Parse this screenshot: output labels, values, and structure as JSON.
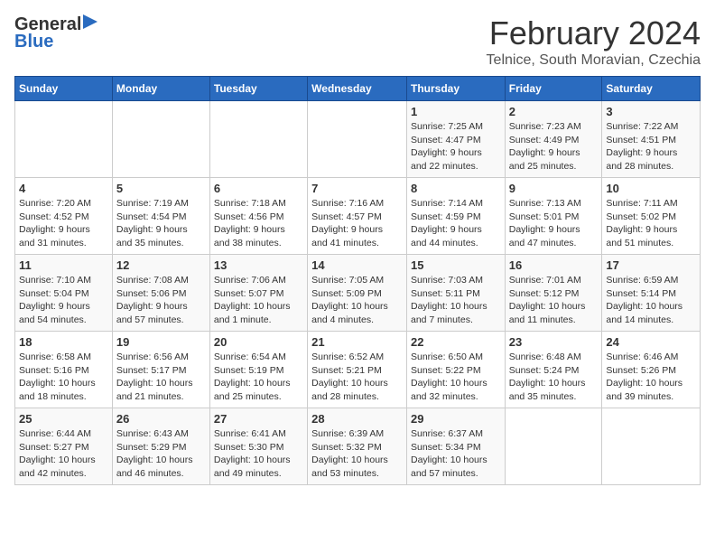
{
  "header": {
    "logo_general": "General",
    "logo_blue": "Blue",
    "month_title": "February 2024",
    "subtitle": "Telnice, South Moravian, Czechia"
  },
  "calendar": {
    "days_of_week": [
      "Sunday",
      "Monday",
      "Tuesday",
      "Wednesday",
      "Thursday",
      "Friday",
      "Saturday"
    ],
    "weeks": [
      [
        {
          "day": "",
          "info": ""
        },
        {
          "day": "",
          "info": ""
        },
        {
          "day": "",
          "info": ""
        },
        {
          "day": "",
          "info": ""
        },
        {
          "day": "1",
          "info": "Sunrise: 7:25 AM\nSunset: 4:47 PM\nDaylight: 9 hours\nand 22 minutes."
        },
        {
          "day": "2",
          "info": "Sunrise: 7:23 AM\nSunset: 4:49 PM\nDaylight: 9 hours\nand 25 minutes."
        },
        {
          "day": "3",
          "info": "Sunrise: 7:22 AM\nSunset: 4:51 PM\nDaylight: 9 hours\nand 28 minutes."
        }
      ],
      [
        {
          "day": "4",
          "info": "Sunrise: 7:20 AM\nSunset: 4:52 PM\nDaylight: 9 hours\nand 31 minutes."
        },
        {
          "day": "5",
          "info": "Sunrise: 7:19 AM\nSunset: 4:54 PM\nDaylight: 9 hours\nand 35 minutes."
        },
        {
          "day": "6",
          "info": "Sunrise: 7:18 AM\nSunset: 4:56 PM\nDaylight: 9 hours\nand 38 minutes."
        },
        {
          "day": "7",
          "info": "Sunrise: 7:16 AM\nSunset: 4:57 PM\nDaylight: 9 hours\nand 41 minutes."
        },
        {
          "day": "8",
          "info": "Sunrise: 7:14 AM\nSunset: 4:59 PM\nDaylight: 9 hours\nand 44 minutes."
        },
        {
          "day": "9",
          "info": "Sunrise: 7:13 AM\nSunset: 5:01 PM\nDaylight: 9 hours\nand 47 minutes."
        },
        {
          "day": "10",
          "info": "Sunrise: 7:11 AM\nSunset: 5:02 PM\nDaylight: 9 hours\nand 51 minutes."
        }
      ],
      [
        {
          "day": "11",
          "info": "Sunrise: 7:10 AM\nSunset: 5:04 PM\nDaylight: 9 hours\nand 54 minutes."
        },
        {
          "day": "12",
          "info": "Sunrise: 7:08 AM\nSunset: 5:06 PM\nDaylight: 9 hours\nand 57 minutes."
        },
        {
          "day": "13",
          "info": "Sunrise: 7:06 AM\nSunset: 5:07 PM\nDaylight: 10 hours\nand 1 minute."
        },
        {
          "day": "14",
          "info": "Sunrise: 7:05 AM\nSunset: 5:09 PM\nDaylight: 10 hours\nand 4 minutes."
        },
        {
          "day": "15",
          "info": "Sunrise: 7:03 AM\nSunset: 5:11 PM\nDaylight: 10 hours\nand 7 minutes."
        },
        {
          "day": "16",
          "info": "Sunrise: 7:01 AM\nSunset: 5:12 PM\nDaylight: 10 hours\nand 11 minutes."
        },
        {
          "day": "17",
          "info": "Sunrise: 6:59 AM\nSunset: 5:14 PM\nDaylight: 10 hours\nand 14 minutes."
        }
      ],
      [
        {
          "day": "18",
          "info": "Sunrise: 6:58 AM\nSunset: 5:16 PM\nDaylight: 10 hours\nand 18 minutes."
        },
        {
          "day": "19",
          "info": "Sunrise: 6:56 AM\nSunset: 5:17 PM\nDaylight: 10 hours\nand 21 minutes."
        },
        {
          "day": "20",
          "info": "Sunrise: 6:54 AM\nSunset: 5:19 PM\nDaylight: 10 hours\nand 25 minutes."
        },
        {
          "day": "21",
          "info": "Sunrise: 6:52 AM\nSunset: 5:21 PM\nDaylight: 10 hours\nand 28 minutes."
        },
        {
          "day": "22",
          "info": "Sunrise: 6:50 AM\nSunset: 5:22 PM\nDaylight: 10 hours\nand 32 minutes."
        },
        {
          "day": "23",
          "info": "Sunrise: 6:48 AM\nSunset: 5:24 PM\nDaylight: 10 hours\nand 35 minutes."
        },
        {
          "day": "24",
          "info": "Sunrise: 6:46 AM\nSunset: 5:26 PM\nDaylight: 10 hours\nand 39 minutes."
        }
      ],
      [
        {
          "day": "25",
          "info": "Sunrise: 6:44 AM\nSunset: 5:27 PM\nDaylight: 10 hours\nand 42 minutes."
        },
        {
          "day": "26",
          "info": "Sunrise: 6:43 AM\nSunset: 5:29 PM\nDaylight: 10 hours\nand 46 minutes."
        },
        {
          "day": "27",
          "info": "Sunrise: 6:41 AM\nSunset: 5:30 PM\nDaylight: 10 hours\nand 49 minutes."
        },
        {
          "day": "28",
          "info": "Sunrise: 6:39 AM\nSunset: 5:32 PM\nDaylight: 10 hours\nand 53 minutes."
        },
        {
          "day": "29",
          "info": "Sunrise: 6:37 AM\nSunset: 5:34 PM\nDaylight: 10 hours\nand 57 minutes."
        },
        {
          "day": "",
          "info": ""
        },
        {
          "day": "",
          "info": ""
        }
      ]
    ]
  }
}
